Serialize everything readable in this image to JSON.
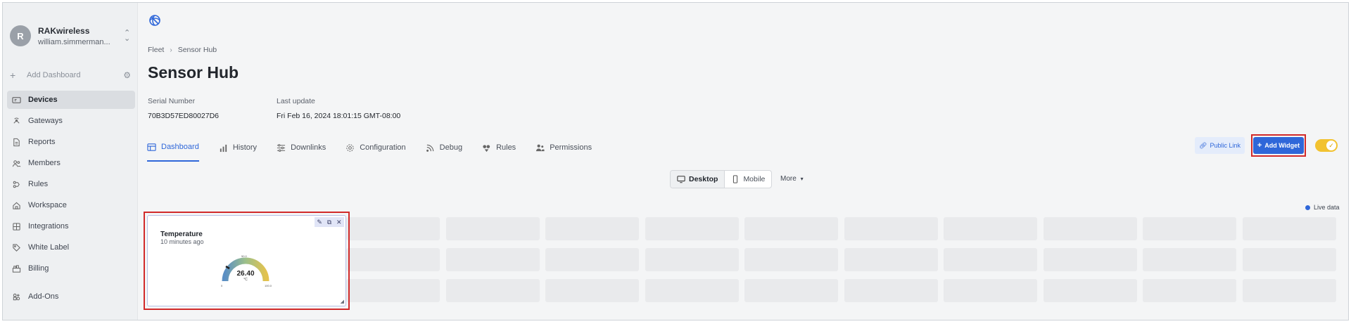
{
  "account": {
    "initial": "R",
    "org": "RAKwireless",
    "user": "william.simmerman..."
  },
  "sidebar": {
    "add_dashboard": "Add Dashboard",
    "items": [
      {
        "label": "Devices",
        "icon": "devices-icon"
      },
      {
        "label": "Gateways",
        "icon": "gateway-icon"
      },
      {
        "label": "Reports",
        "icon": "document-icon"
      },
      {
        "label": "Members",
        "icon": "users-icon"
      },
      {
        "label": "Rules",
        "icon": "rules-icon"
      },
      {
        "label": "Workspace",
        "icon": "home-icon"
      },
      {
        "label": "Integrations",
        "icon": "grid-icon"
      },
      {
        "label": "White Label",
        "icon": "tag-icon"
      },
      {
        "label": "Billing",
        "icon": "billing-icon"
      }
    ],
    "addons": "Add-Ons"
  },
  "breadcrumb": {
    "root": "Fleet",
    "current": "Sensor Hub"
  },
  "page_title": "Sensor Hub",
  "meta": {
    "serial_label": "Serial Number",
    "serial_value": "70B3D57ED80027D6",
    "update_label": "Last update",
    "update_value": "Fri Feb 16, 2024 18:01:15 GMT-08:00"
  },
  "tabs": [
    "Dashboard",
    "History",
    "Downlinks",
    "Configuration",
    "Debug",
    "Rules",
    "Permissions"
  ],
  "actions": {
    "public_link": "Public Link",
    "add_widget": "Add Widget",
    "toggle_checked": true
  },
  "view": {
    "desktop": "Desktop",
    "mobile": "Mobile",
    "more": "More"
  },
  "live_data": "Live data",
  "widget": {
    "title": "Temperature",
    "time": "10 minutes ago",
    "value": "26.40",
    "unit": "°C",
    "min": "0",
    "mid": "50.0",
    "max": "100.0"
  },
  "colors": {
    "accent": "#2f67d9",
    "highlight": "#d12a2a",
    "toggle": "#f2c230"
  }
}
